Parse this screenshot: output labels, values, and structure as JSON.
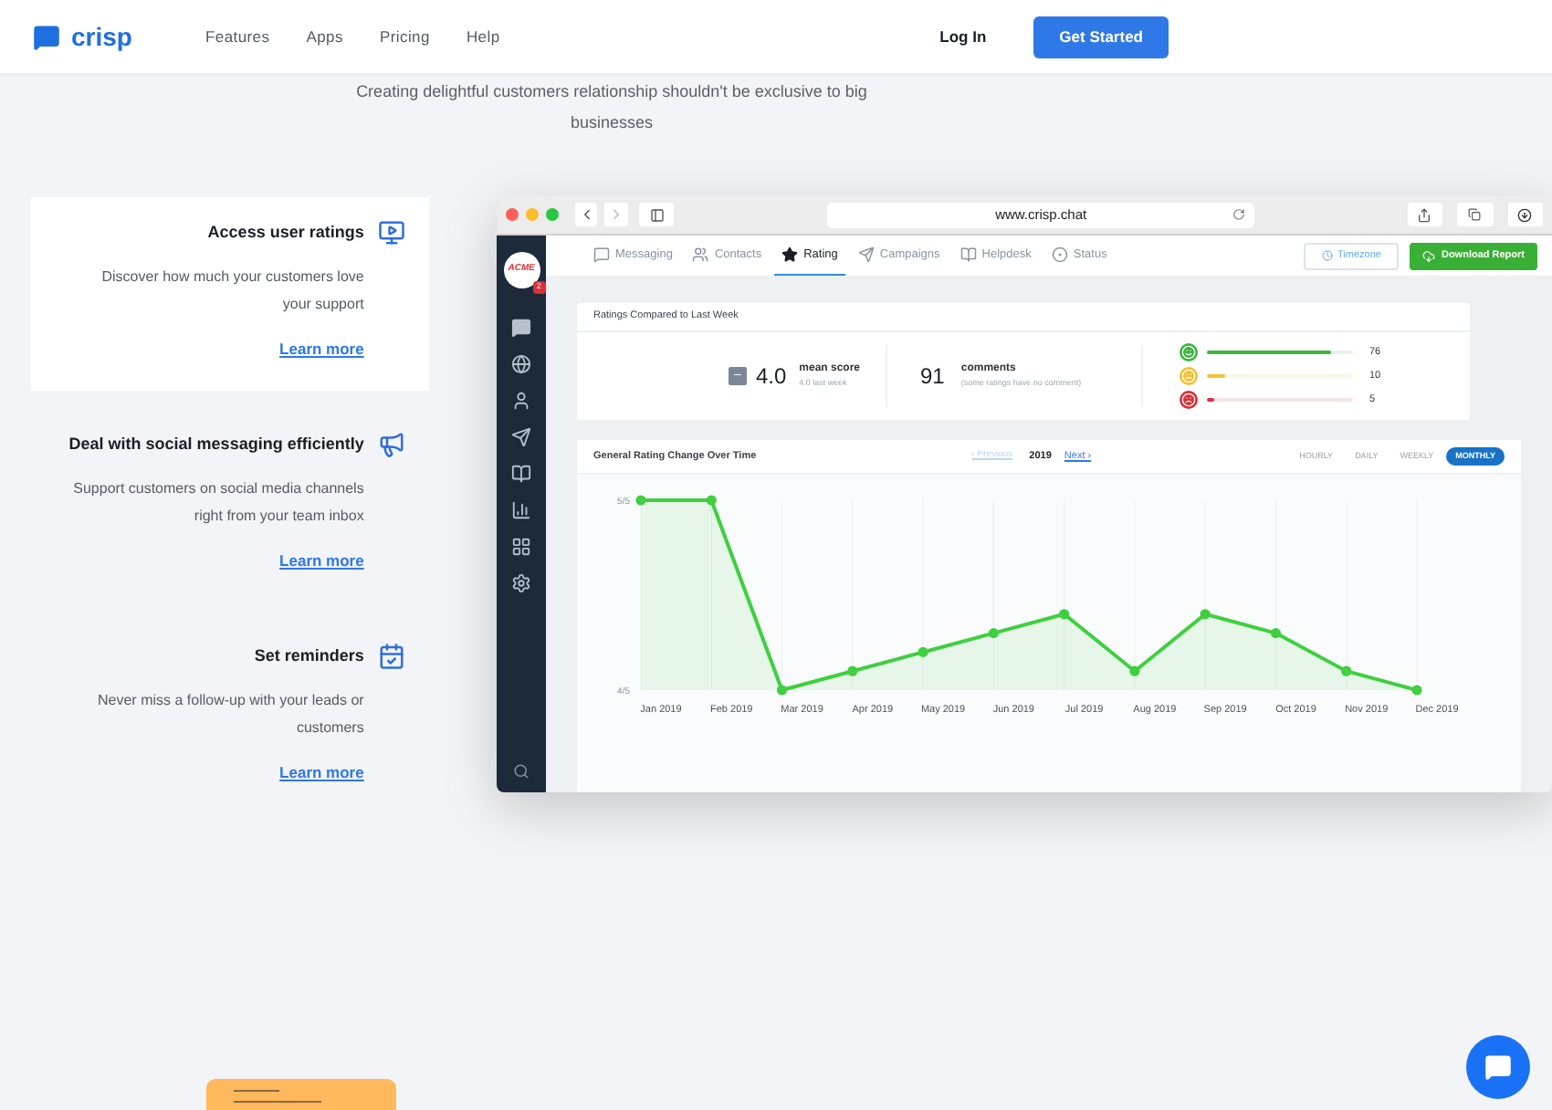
{
  "header": {
    "logo": "crisp",
    "nav": [
      "Features",
      "Apps",
      "Pricing",
      "Help"
    ],
    "login": "Log In",
    "cta": "Get Started"
  },
  "hero": {
    "subtitle": "Creating delightful customers relationship shouldn't be exclusive to big businesses"
  },
  "features": [
    {
      "title": "Access user ratings",
      "text": "Discover how much your customers love your support",
      "link": "Learn more",
      "selected": true,
      "kind": "rating"
    },
    {
      "title": "Deal with social messaging efficiently",
      "text": "Support customers on social media channels right from your team inbox",
      "link": "Learn more",
      "selected": false,
      "kind": "social"
    },
    {
      "title": "Set reminders",
      "text": "Never miss a follow-up with your leads or customers",
      "link": "Learn more",
      "selected": false,
      "kind": "reminder"
    }
  ],
  "browser": {
    "url": "www.crisp.chat"
  },
  "app": {
    "avatar": "ACME",
    "badge": "2",
    "tabs": [
      {
        "label": "Messaging",
        "selected": false,
        "kind": "chat"
      },
      {
        "label": "Contacts",
        "selected": false,
        "kind": "people"
      },
      {
        "label": "Rating",
        "selected": true,
        "kind": "star"
      },
      {
        "label": "Campaigns",
        "selected": false,
        "kind": "send"
      },
      {
        "label": "Helpdesk",
        "selected": false,
        "kind": "book"
      },
      {
        "label": "Status",
        "selected": false,
        "kind": "status"
      }
    ],
    "timezone": "Timezone",
    "download": "Download Report",
    "summary": {
      "title": "Ratings Compared to Last Week",
      "trend": "–",
      "score": "4.0",
      "score_label": "mean score",
      "score_sub": "4.0 last week",
      "comments": "91",
      "comments_label": "comments",
      "comments_sub": "(some ratings have no comment)",
      "bars": [
        {
          "kind": "happy",
          "level": 0.85,
          "count": "76",
          "color": "#3cb43c"
        },
        {
          "kind": "neutral",
          "level": 0.12,
          "count": "10",
          "color": "#f2c230"
        },
        {
          "kind": "sad",
          "level": 0.05,
          "count": "5",
          "color": "#d9303a"
        }
      ]
    },
    "chart_panel": {
      "title": "General Rating Change Over Time",
      "previous": "‹ Previous",
      "year": "2019",
      "next": "Next ›",
      "periods": [
        {
          "label": "HOURLY",
          "selected": false
        },
        {
          "label": "DAILY",
          "selected": false
        },
        {
          "label": "WEEKLY",
          "selected": false
        },
        {
          "label": "MONTHLY",
          "selected": true
        }
      ],
      "chart_data": {
        "type": "area",
        "categories": [
          "Jan 2019",
          "Feb 2019",
          "Mar 2019",
          "Apr 2019",
          "May 2019",
          "Jun 2019",
          "Jul 2019",
          "Aug 2019",
          "Sep 2019",
          "Oct 2019",
          "Nov 2019",
          "Dec 2019"
        ],
        "series": [
          {
            "color": "#3fcf3f",
            "values": [
              1,
              1,
              0.8,
              0.82,
              0.84,
              0.86,
              0.88,
              0.82,
              0.88,
              0.86,
              0.82,
              0.8
            ]
          }
        ],
        "ylim": [
          0.8,
          1
        ],
        "yticks": [
          {
            "value": 1,
            "label": "5/5"
          },
          {
            "value": 0.8,
            "label": "4/5"
          }
        ]
      }
    }
  }
}
